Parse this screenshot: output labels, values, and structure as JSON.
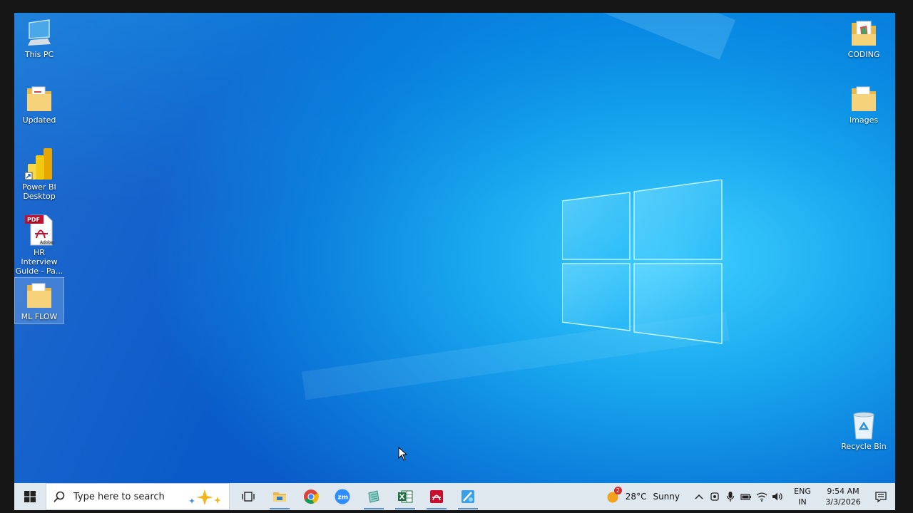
{
  "desktop": {
    "left_icons": [
      {
        "label": "This PC",
        "icon": "computer-icon"
      },
      {
        "label": "Updated",
        "icon": "folder-icon"
      },
      {
        "label": "Power BI Desktop",
        "icon": "power-bi-icon"
      },
      {
        "label": "HR Interview Guide - Pa...",
        "icon": "pdf-file-icon"
      },
      {
        "label": "ML FLOW",
        "icon": "folder-icon"
      }
    ],
    "right_icons": [
      {
        "label": "CODING",
        "icon": "folder-icon"
      },
      {
        "label": "Images",
        "icon": "folder-icon"
      },
      {
        "label": "Recycle Bin",
        "icon": "recycle-bin-icon"
      }
    ],
    "pdf_badge": "PDF",
    "pdf_brand": "Adobe"
  },
  "taskbar": {
    "search_placeholder": "Type here to search",
    "pinned": [
      "task-view-icon",
      "file-explorer-icon",
      "chrome-icon",
      "zoom-icon",
      "notepad-icon",
      "excel-icon",
      "acrobat-icon",
      "paint-icon"
    ],
    "weather": {
      "temp": "28°C",
      "condition": "Sunny",
      "badge": "2"
    },
    "language": {
      "line1": "ENG",
      "line2": "IN"
    },
    "clock": {
      "time": "9:54 AM",
      "date": "3/3/2026"
    }
  },
  "colors": {
    "taskbar_bg": "#dfe7ef",
    "accent": "#0a5bc9",
    "wallpaper_glow": "#3fd0ff"
  }
}
